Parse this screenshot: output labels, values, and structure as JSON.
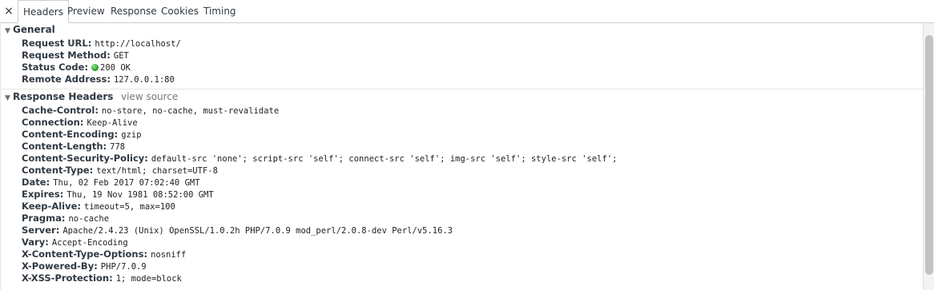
{
  "tabs": {
    "close_symbol": "×",
    "items": [
      "Headers",
      "Preview",
      "Response",
      "Cookies",
      "Timing"
    ],
    "active": "Headers"
  },
  "general": {
    "title": "General",
    "rows": [
      {
        "key": "Request URL:",
        "value": "http://localhost/"
      },
      {
        "key": "Request Method:",
        "value": "GET"
      },
      {
        "key": "Status Code:",
        "value": "200 OK",
        "status_color": "#1f9a22"
      },
      {
        "key": "Remote Address:",
        "value": "127.0.0.1:80"
      }
    ]
  },
  "response_headers": {
    "title": "Response Headers",
    "view_source": "view source",
    "rows": [
      {
        "key": "Cache-Control:",
        "value": "no-store, no-cache, must-revalidate"
      },
      {
        "key": "Connection:",
        "value": "Keep-Alive"
      },
      {
        "key": "Content-Encoding:",
        "value": "gzip"
      },
      {
        "key": "Content-Length:",
        "value": "778"
      },
      {
        "key": "Content-Security-Policy:",
        "value": "default-src 'none'; script-src 'self'; connect-src 'self'; img-src 'self'; style-src 'self';"
      },
      {
        "key": "Content-Type:",
        "value": "text/html; charset=UTF-8"
      },
      {
        "key": "Date:",
        "value": "Thu, 02 Feb 2017 07:02:40 GMT"
      },
      {
        "key": "Expires:",
        "value": "Thu, 19 Nov 1981 08:52:00 GMT"
      },
      {
        "key": "Keep-Alive:",
        "value": "timeout=5, max=100"
      },
      {
        "key": "Pragma:",
        "value": "no-cache"
      },
      {
        "key": "Server:",
        "value": "Apache/2.4.23 (Unix) OpenSSL/1.0.2h PHP/7.0.9 mod_perl/2.0.8-dev Perl/v5.16.3"
      },
      {
        "key": "Vary:",
        "value": "Accept-Encoding"
      },
      {
        "key": "X-Content-Type-Options:",
        "value": "nosniff"
      },
      {
        "key": "X-Powered-By:",
        "value": "PHP/7.0.9"
      },
      {
        "key": "X-XSS-Protection:",
        "value": "1; mode=block"
      }
    ]
  },
  "icons": {
    "close": "close-icon",
    "expand": "triangle-down-icon",
    "status": "status-dot-icon"
  }
}
